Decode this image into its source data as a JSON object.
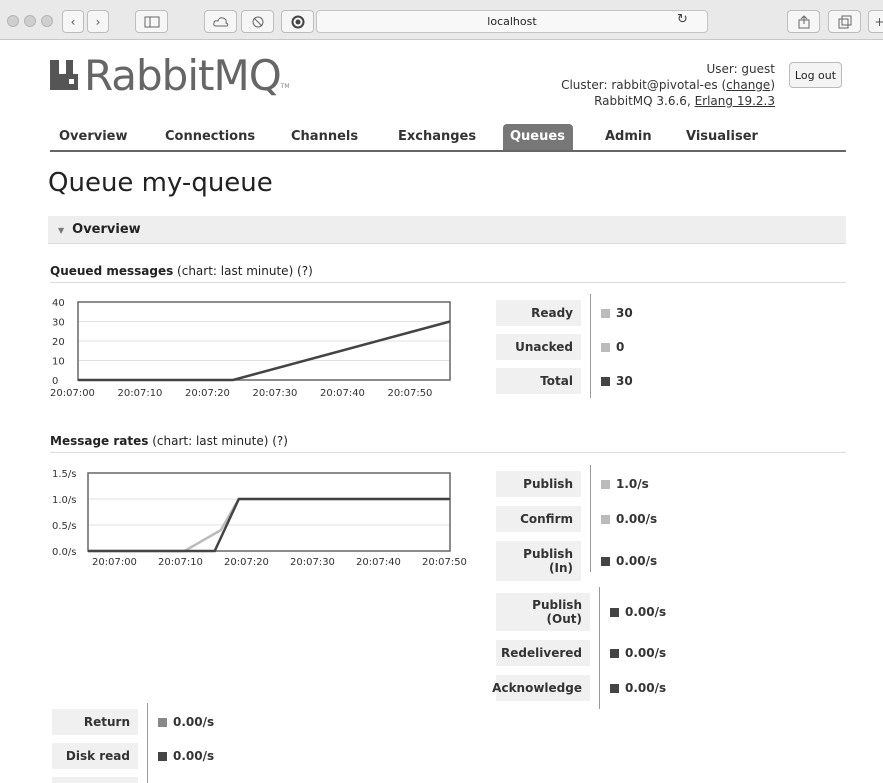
{
  "browser": {
    "url": "localhost"
  },
  "header": {
    "logo_text": "RabbitMQ",
    "logo_tm": "TM",
    "user_line": "User: guest",
    "cluster_prefix": "Cluster: ",
    "cluster_name": "rabbit@pivotal-es",
    "cluster_change": "change",
    "version": "RabbitMQ 3.6.6, ",
    "erlang": "Erlang 19.2.3",
    "logout_label": "Log out"
  },
  "nav": {
    "tabs": [
      "Overview",
      "Connections",
      "Channels",
      "Exchanges",
      "Queues",
      "Admin",
      "Visualiser"
    ],
    "active": "Queues"
  },
  "page_title": "Queue my-queue",
  "section": {
    "title": "Overview"
  },
  "queued": {
    "heading_bold": "Queued messages",
    "heading_rest": " (chart: last minute) (?)",
    "stats": [
      {
        "label": "Ready",
        "value": "30",
        "color": "#bbbbbb"
      },
      {
        "label": "Unacked",
        "value": "0",
        "color": "#bbbbbb"
      },
      {
        "label": "Total",
        "value": "30",
        "color": "#444444"
      }
    ]
  },
  "rates": {
    "heading_bold": "Message rates",
    "heading_rest": " (chart: last minute) (?)",
    "stats": [
      {
        "label": "Publish",
        "value": "1.0/s",
        "color": "#bbbbbb"
      },
      {
        "label": "Confirm",
        "value": "0.00/s",
        "color": "#bbbbbb"
      },
      {
        "label": "Publish (In)",
        "value": "0.00/s",
        "color": "#444444"
      }
    ],
    "stats2": [
      {
        "label": "Publish (Out)",
        "value": "0.00/s",
        "color": "#444444"
      },
      {
        "label": "Redelivered",
        "value": "0.00/s",
        "color": "#444444"
      },
      {
        "label": "Acknowledge",
        "value": "0.00/s",
        "color": "#444444"
      }
    ],
    "stats3": [
      {
        "label": "Return",
        "value": "0.00/s",
        "color": "#888888"
      },
      {
        "label": "Disk read",
        "value": "0.00/s",
        "color": "#444444"
      }
    ]
  },
  "chart_data": [
    {
      "type": "line",
      "x": [
        "20:07:00",
        "20:07:10",
        "20:07:20",
        "20:07:30",
        "20:07:40",
        "20:07:50"
      ],
      "y_ticks": [
        "0",
        "10",
        "20",
        "30",
        "40"
      ],
      "ylim": [
        0,
        40
      ],
      "series": [
        {
          "name": "Total",
          "color": "#444444",
          "points": [
            [
              0,
              0
            ],
            [
              25,
              0
            ],
            [
              60,
              30
            ]
          ]
        }
      ]
    },
    {
      "type": "line",
      "x": [
        "20:07:00",
        "20:07:10",
        "20:07:20",
        "20:07:30",
        "20:07:40",
        "20:07:50"
      ],
      "y_ticks": [
        "0.0/s",
        "0.5/s",
        "1.0/s",
        "1.5/s"
      ],
      "ylim": [
        0,
        1.5
      ],
      "series": [
        {
          "name": "Publish",
          "color": "#bbbbbb",
          "points": [
            [
              0,
              0
            ],
            [
              16,
              0
            ],
            [
              22,
              0.4
            ],
            [
              25,
              1.0
            ],
            [
              60,
              1.0
            ]
          ]
        },
        {
          "name": "Publish (In)",
          "color": "#444444",
          "points": [
            [
              0,
              0
            ],
            [
              21,
              0
            ],
            [
              25,
              1.0
            ],
            [
              60,
              1.0
            ]
          ]
        }
      ]
    }
  ]
}
